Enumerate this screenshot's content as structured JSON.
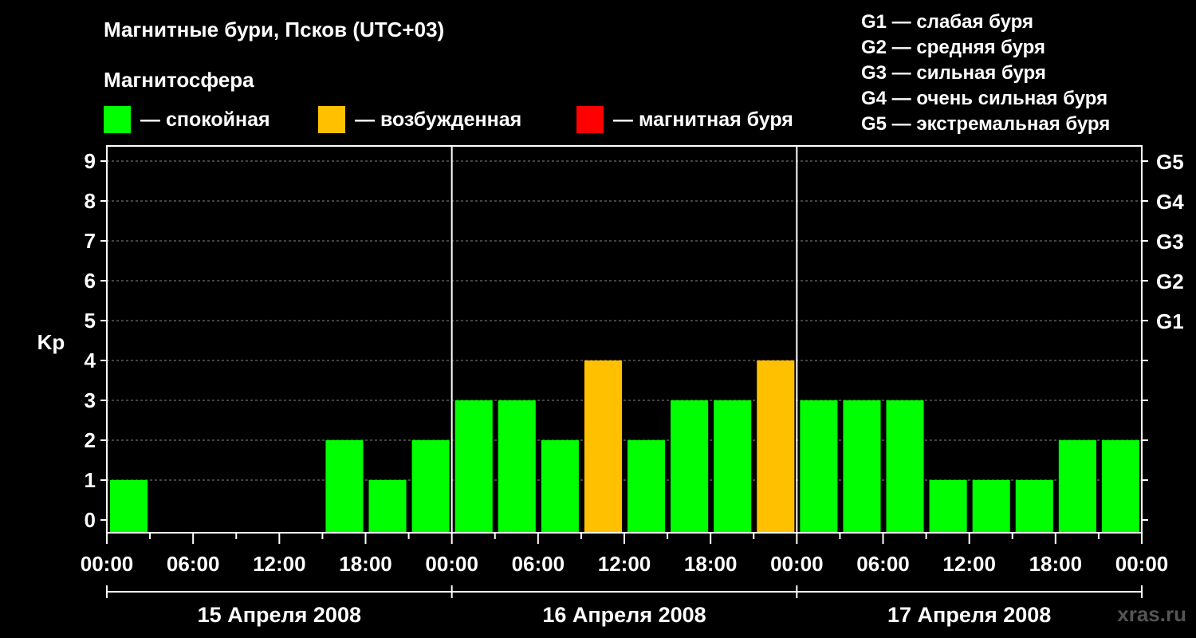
{
  "title": "Магнитные бури, Псков (UTC+03)",
  "subtitle": "Магнитосфера",
  "legend": [
    {
      "label": "— спокойная",
      "color": "#00ff00"
    },
    {
      "label": "— возбужденная",
      "color": "#ffc000"
    },
    {
      "label": "— магнитная буря",
      "color": "#ff0000"
    }
  ],
  "storm_legend": [
    "G1 — слабая буря",
    "G2 — средняя буря",
    "G3 — сильная буря",
    "G4 — очень сильная буря",
    "G5 — экстремальная буря"
  ],
  "watermark": "xras.ru",
  "chart_data": {
    "type": "bar",
    "ylabel": "Kp",
    "ylim": [
      0,
      9
    ],
    "y_ticks": [
      "0",
      "1",
      "2",
      "3",
      "4",
      "5",
      "6",
      "7",
      "8",
      "9"
    ],
    "g_scale": [
      {
        "label": "G1",
        "kp": 5
      },
      {
        "label": "G2",
        "kp": 6
      },
      {
        "label": "G3",
        "kp": 7
      },
      {
        "label": "G4",
        "kp": 8
      },
      {
        "label": "G5",
        "kp": 9
      }
    ],
    "x_ticks": [
      "00:00",
      "06:00",
      "12:00",
      "18:00",
      "00:00",
      "06:00",
      "12:00",
      "18:00",
      "00:00",
      "06:00",
      "12:00",
      "18:00",
      "00:00"
    ],
    "days": [
      "15 Апреля 2008",
      "16 Апреля 2008",
      "17 Апреля 2008"
    ],
    "grid": true,
    "values": [
      1,
      0,
      0,
      0,
      0,
      2,
      1,
      2,
      3,
      3,
      2,
      4,
      2,
      3,
      3,
      4,
      3,
      3,
      3,
      1,
      1,
      1,
      2,
      2
    ],
    "colors": [
      "green",
      "green",
      "green",
      "green",
      "green",
      "green",
      "green",
      "green",
      "green",
      "green",
      "green",
      "orange",
      "green",
      "green",
      "green",
      "orange",
      "green",
      "green",
      "green",
      "green",
      "green",
      "green",
      "green",
      "green"
    ],
    "palette": {
      "green": "#00ff00",
      "orange": "#ffc000",
      "red": "#ff0000"
    }
  }
}
